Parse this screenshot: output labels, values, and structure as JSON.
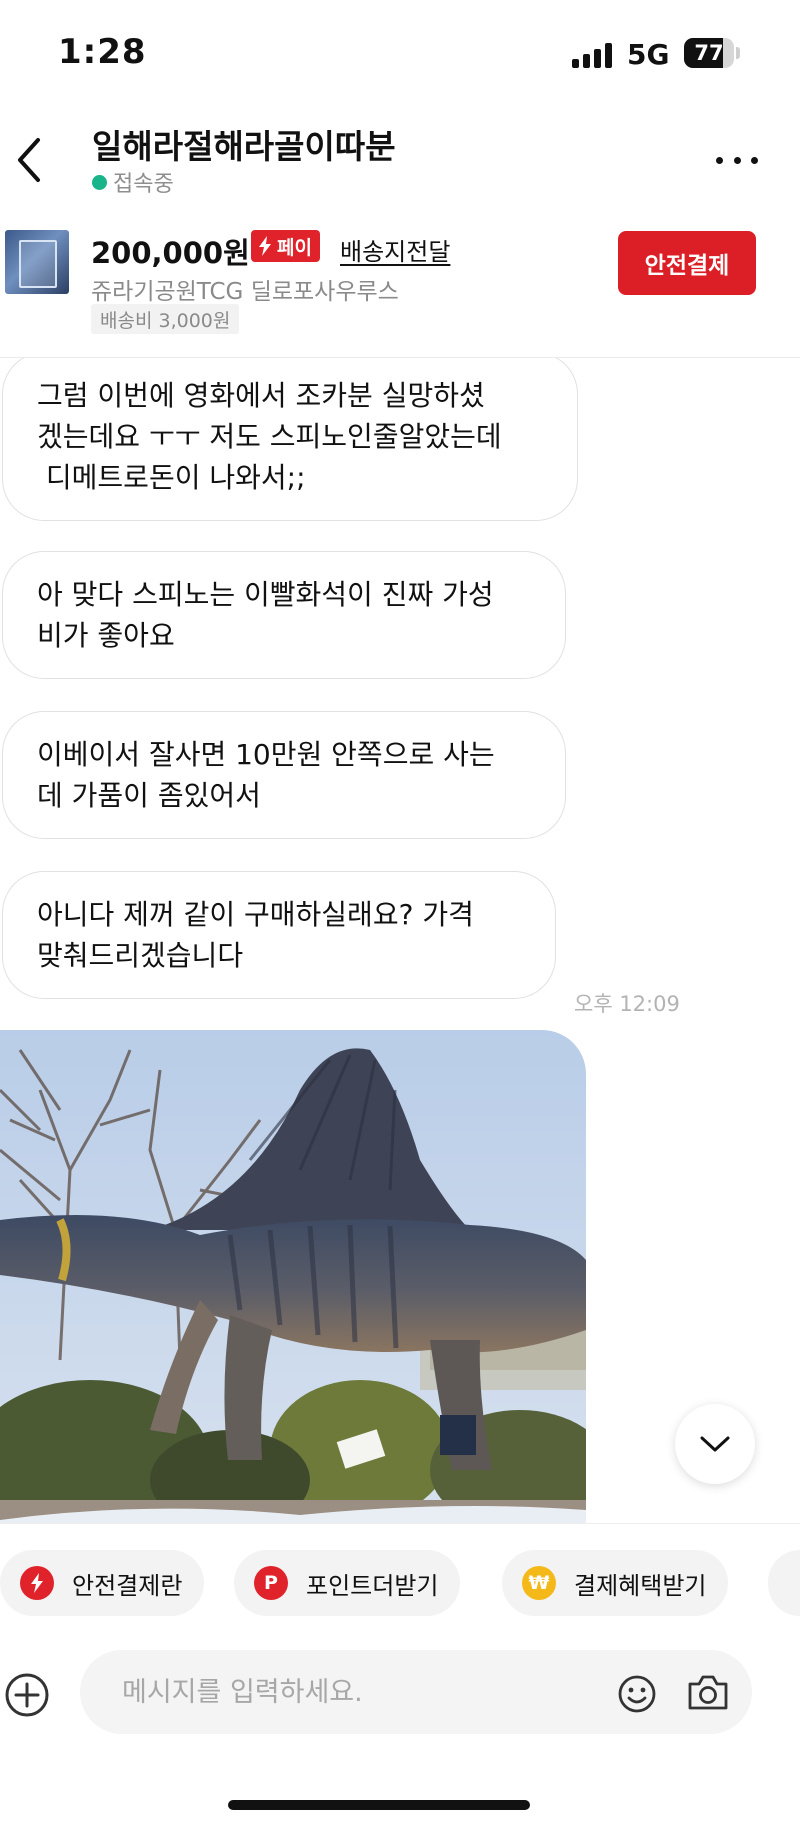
{
  "status_bar": {
    "time": "1:28",
    "network": "5G",
    "battery": "77",
    "battery_level": 0.77
  },
  "header": {
    "title": "일해라절해라골이따분",
    "presence": "접속중",
    "presence_color": "#19b48a"
  },
  "product": {
    "price": "200,000원",
    "pay_badge": "페이",
    "delivery": "배송지전달",
    "name": "쥬라기공원TCG 딜로포사우루스",
    "shipping": "배송비 3,000원",
    "safe_pay_button": "안전결제",
    "accent_color": "#dc1f26"
  },
  "messages": [
    {
      "text": "그럼 이번에 영화에서 조카분 실망하셨\n겠는데요 ㅜㅜ 저도 스피노인줄알았는데\n 디메트로돈이 나와서;;"
    },
    {
      "text": "아 맞다 스피노는 이빨화석이 진짜 가성\n비가 좋아요"
    },
    {
      "text": "이베이서 잘사면 10만원 안쪽으로 사는\n데 가품이 좀있어서"
    },
    {
      "text": "아니다 제꺼 같이 구매하실래요? 가격\n맞춰드리겠습니다",
      "time": "오후 12:09"
    }
  ],
  "photo": {
    "subject": "dinosaur-statue"
  },
  "quick_actions": [
    {
      "label": "안전결제란",
      "icon": "bolt-icon",
      "color": "#e0222a"
    },
    {
      "label": "포인트더받기",
      "icon": "point-icon",
      "color": "#e0222a",
      "glyph": "P"
    },
    {
      "label": "결제혜택받기",
      "icon": "won-coin-icon",
      "color": "#f5b819",
      "glyph": "₩"
    }
  ],
  "composer": {
    "placeholder": "메시지를 입력하세요."
  }
}
